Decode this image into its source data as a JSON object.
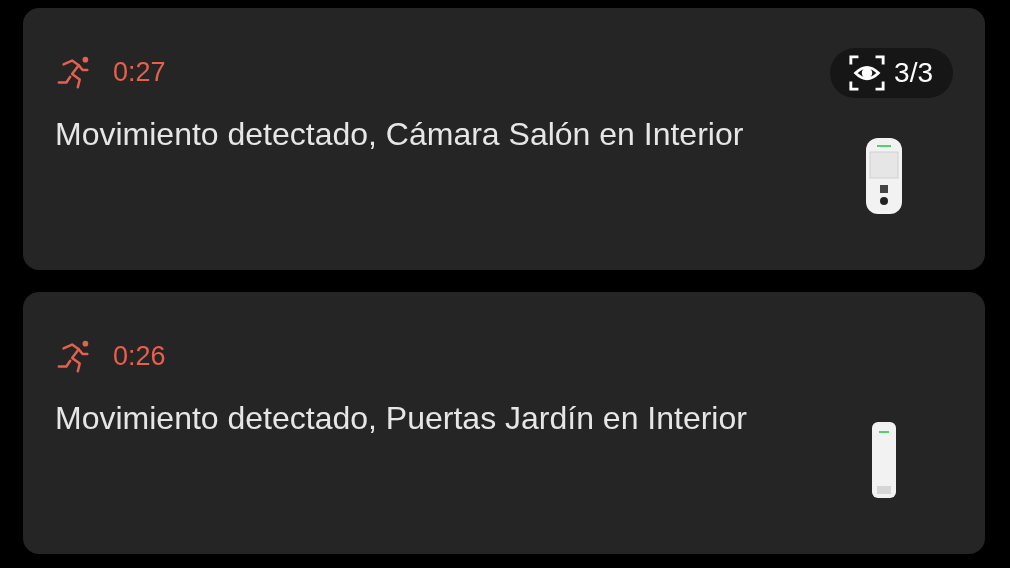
{
  "events": [
    {
      "time": "0:27",
      "message": "Movimiento detectado, Cámara Salón en Interior",
      "badge": "3/3",
      "device": {
        "kind": "camera"
      }
    },
    {
      "time": "0:26",
      "message": "Movimiento detectado, Puertas Jardín en Interior",
      "device": {
        "kind": "slim"
      }
    }
  ]
}
